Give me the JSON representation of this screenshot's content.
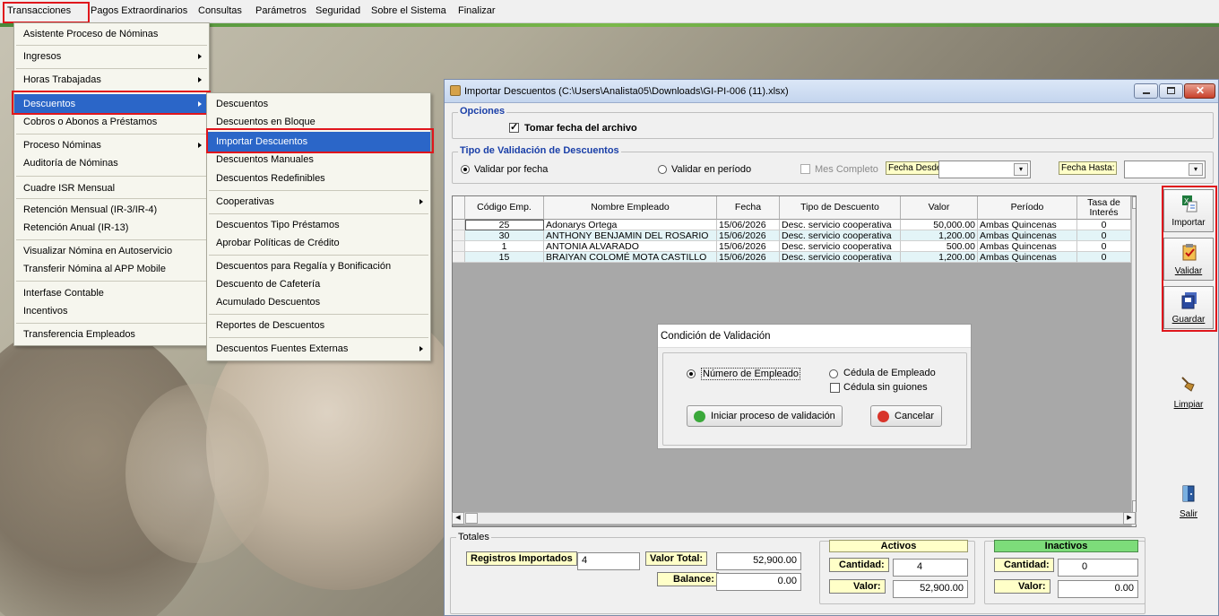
{
  "menubar": {
    "items": [
      "Transacciones",
      "Pagos Extraordinarios",
      "Consultas",
      "Parámetros",
      "Seguridad",
      "Sobre el Sistema",
      "Finalizar"
    ]
  },
  "menu1": {
    "items": [
      "Asistente Proceso de Nóminas",
      "Ingresos",
      "Horas Trabajadas",
      "Descuentos",
      "Cobros o Abonos a Préstamos",
      "Proceso Nóminas",
      "Auditoría de Nóminas",
      "Cuadre ISR Mensual",
      "Retención Mensual  (IR-3/IR-4)",
      "Retención Anual  (IR-13)",
      "Visualizar Nómina en Autoservicio",
      "Transferir Nómina al APP Mobile",
      "Interfase Contable",
      "Incentivos",
      "Transferencia Empleados"
    ]
  },
  "menu2": {
    "items": [
      "Descuentos",
      "Descuentos en Bloque",
      "Importar Descuentos",
      "Descuentos Manuales",
      "Descuentos Redefinibles",
      "Cooperativas",
      "Descuentos Tipo Préstamos",
      "Aprobar Políticas de Crédito",
      "Descuentos  para Regalía y Bonificación",
      "Descuento de Cafetería",
      "Acumulado Descuentos",
      "Reportes de Descuentos",
      "Descuentos Fuentes Externas"
    ]
  },
  "window": {
    "title": "Importar Descuentos (C:\\Users\\Analista05\\Downloads\\GI-PI-006 (11).xlsx)",
    "opciones": {
      "legend": "Opciones",
      "checkbox": "Tomar fecha del archivo"
    },
    "tipo": {
      "legend": "Tipo de Validación de Descuentos",
      "r1": "Validar por fecha",
      "r2": "Validar en período",
      "mes": "Mes Completo",
      "desde": "Fecha Desde:",
      "hasta": "Fecha Hasta:"
    },
    "table": {
      "headers": [
        "Código Emp.",
        "Nombre Empleado",
        "Fecha",
        "Tipo de Descuento",
        "Valor",
        "Período",
        "Tasa de Interés"
      ],
      "rows": [
        [
          "25",
          "Adonarys Ortega",
          "15/06/2026",
          "Desc. servicio cooperativa",
          "50,000.00",
          "Ambas Quincenas",
          "0"
        ],
        [
          "30",
          "ANTHONY BENJAMIN DEL ROSARIO",
          "15/06/2026",
          "Desc. servicio cooperativa",
          "1,200.00",
          "Ambas Quincenas",
          "0"
        ],
        [
          "1",
          "ANTONIA ALVARADO",
          "15/06/2026",
          "Desc. servicio cooperativa",
          "500.00",
          "Ambas Quincenas",
          "0"
        ],
        [
          "15",
          "BRAIYAN COLOMÉ MOTA CASTILLO",
          "15/06/2026",
          "Desc. servicio cooperativa",
          "1,200.00",
          "Ambas Quincenas",
          "0"
        ]
      ]
    },
    "buttons": {
      "importar": "Importar",
      "validar": "Validar",
      "guardar": "Guardar",
      "limpiar": "Limpiar",
      "salir": "Salir"
    },
    "totales": {
      "legend": "Totales",
      "reg_label": "Registros Importados",
      "reg_val": "4",
      "vt_label": "Valor Total:",
      "vt_val": "52,900.00",
      "bal_label": "Balance:",
      "bal_val": "0.00",
      "activos": "Activos",
      "inactivos": "Inactivos",
      "cant_label": "Cantidad:",
      "valor_label": "Valor:",
      "act_cant": "4",
      "act_val": "52,900.00",
      "inact_cant": "0",
      "inact_val": "0.00"
    }
  },
  "dialog": {
    "title": "Condición de Validación",
    "r1": "Número de Empleado",
    "r2": "Cédula de Empleado",
    "chk": "Cédula sin guiones",
    "btn_ok": "Iniciar proceso de validación",
    "btn_cancel": "Cancelar"
  },
  "colors": {
    "highlight": "#e0161c",
    "menu_select": "#2b66c8",
    "legend_blue": "#1a3fa8",
    "row_alt": "#e3f4f7"
  }
}
